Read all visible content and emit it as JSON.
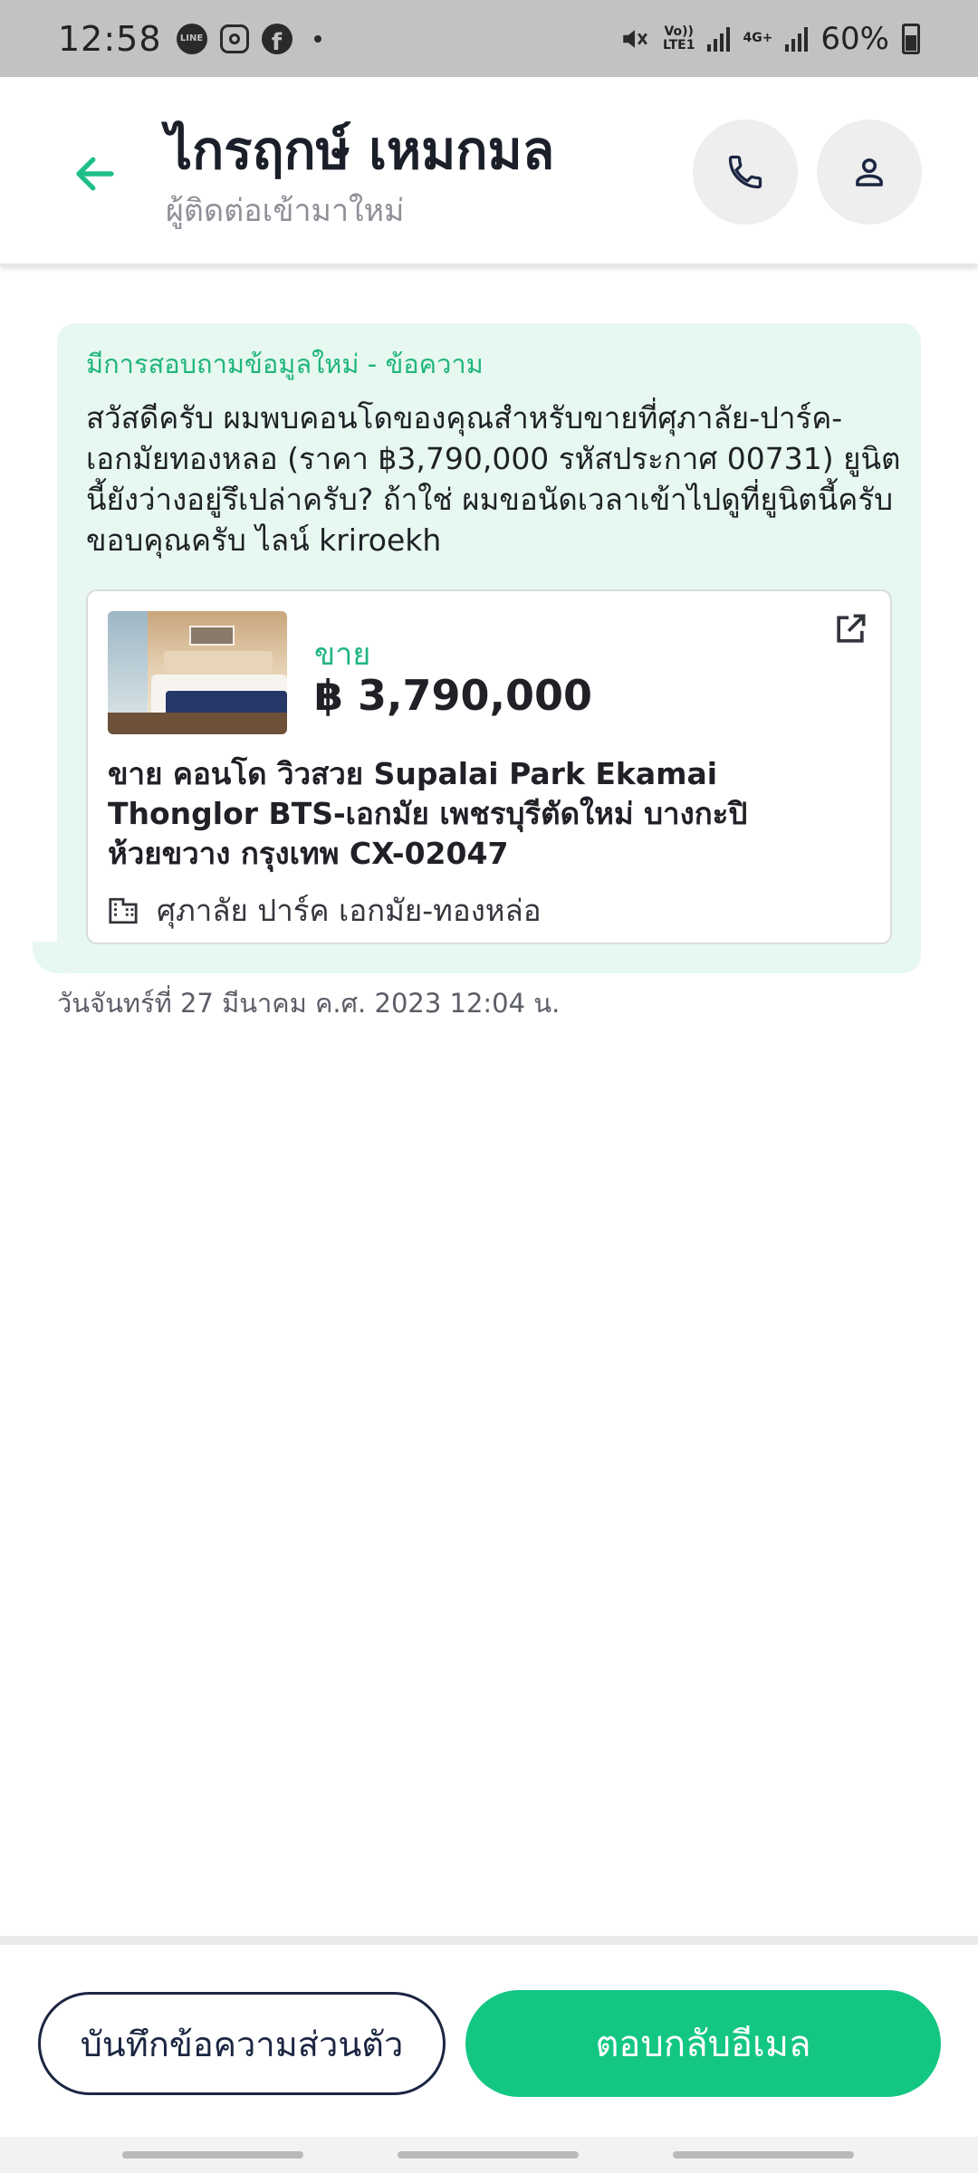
{
  "status_bar": {
    "time": "12:58",
    "line_icon": "LINE",
    "fb_icon": "f",
    "volte": "Vo))",
    "lte": "LTE1",
    "net": "4G+",
    "battery": "60%"
  },
  "header": {
    "title": "ไกรฤกษ์ เหมกมล",
    "subtitle": "ผู้ติดต่อเข้ามาใหม่"
  },
  "message": {
    "label": "มีการสอบถามข้อมูลใหม่ - ข้อความ",
    "text": "สวัสดีครับ ผมพบคอนโดของคุณสำหรับขายที่ศุภาลัย-ปาร์ค-เอกมัยทองหลอ (ราคา ฿3,790,000 รหัสประกาศ 00731) ยูนิตนี้ยังว่างอยู่รึเปล่าครับ? ถ้าใช่ ผมขอนัดเวลาเข้าไปดูที่ยูนิตนี้ครับ ขอบคุณครับ ไลน์ kriroekh",
    "timestamp": "วันจันทร์ที่ 27 มีนาคม ค.ศ. 2023 12:04 น."
  },
  "listing": {
    "type": "ขาย",
    "price": "฿ 3,790,000",
    "title": "ขาย คอนโด วิวสวย Supalai Park Ekamai Thonglor BTS-เอกมัย เพชรบุรีตัดใหม่ บางกะปิ ห้วยขวาง กรุงเทพ CX-02047",
    "building": "ศุภาลัย ปาร์ค เอกมัย-ทองหล่อ"
  },
  "actions": {
    "note_label": "บันทึกข้อความส่วนตัว",
    "reply_label": "ตอบกลับอีเมล"
  },
  "colors": {
    "accent": "#13c783",
    "bubble_bg": "#e7f8f0",
    "navy": "#1b2642"
  },
  "icons": [
    "back-arrow-icon",
    "phone-icon",
    "contact-icon",
    "external-link-icon",
    "building-icon"
  ]
}
